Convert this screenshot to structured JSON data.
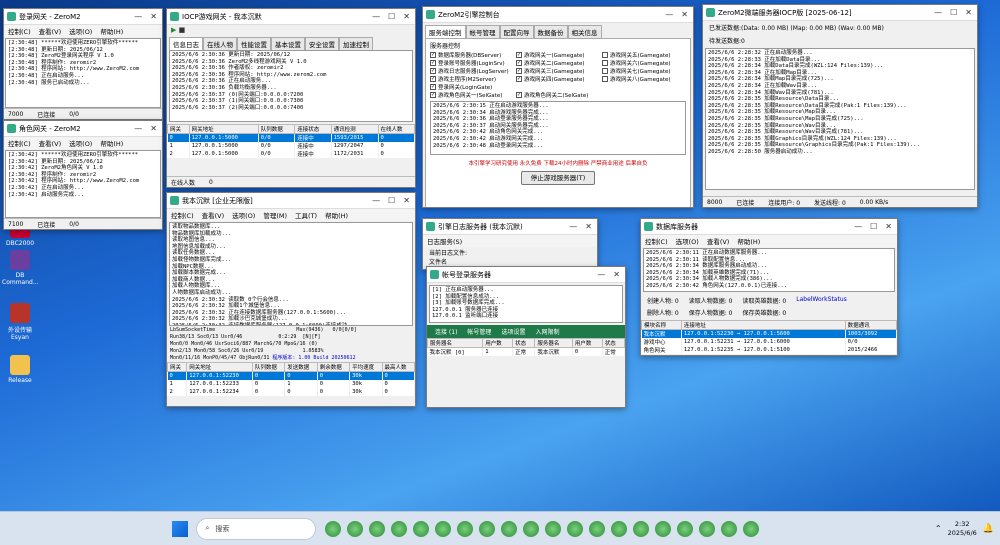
{
  "desktop": {
    "icons": [
      {
        "label": "DBC2000"
      },
      {
        "label": "DB Command..."
      },
      {
        "label": "外设传输 Esyan"
      },
      {
        "label": "Release"
      }
    ]
  },
  "w_gate": {
    "title": "登录网关 - ZeroM2",
    "menu": [
      "控制(C)",
      "查看(V)",
      "选项(O)",
      "帮助(H)"
    ],
    "log": "[2:30:48] ******欢迎使用ZERO引擎软件******\n[2:30:48] 更新日期: 2025/06/12\n[2:30:48] ZeroM2登录网关程序 V 1.0\n[2:30:48] 程序制作: zeromir2\n[2:30:48] 程序网站: http://www.ZeroM2.com\n[2:30:48] 正在启动服务...\n[2:30:48] 服务已启动成功...",
    "status": [
      "7000",
      "已连接",
      "0/0"
    ]
  },
  "w_selgate": {
    "title": "角色网关 - ZeroM2",
    "menu": [
      "控制(C)",
      "查看(V)",
      "选项(O)",
      "帮助(H)"
    ],
    "log": "[2:30:42] ******欢迎使用ZERO引擎软件******\n[2:30:42] 更新日期: 2025/06/12\n[2:30:42] ZeroM2角色网关 V 1.0\n[2:30:42] 程序制作: zeromir2\n[2:30:42] 程序网站: http://www.ZeroM2.com\n[2:30:42] 正在启动服务...\n[2:30:42] 启动服务完成...",
    "status": [
      "7100",
      "已连接",
      "0/0"
    ]
  },
  "w_iocp": {
    "title": "IOCP游戏网关 - 我本沉默",
    "tabs": [
      "信息日志",
      "在线人物",
      "性能设置",
      "基本设置",
      "安全设置",
      "加速控制"
    ],
    "log": "2025/6/6 2:30:36 更新日期: 2025/06/12\n2025/6/6 2:30:36 ZeroM2多线程游戏网关 V 1.0\n2025/6/6 2:30:36 作者版权: zeromir2\n2025/6/6 2:30:36 程序网站: http://www.zerom2.com\n2025/6/6 2:30:36 正在启动服务...\n2025/6/6 2:30:36 负载均衡服务器...\n2025/6/6 2:30:37 (0)网关端口:0.0.0.0:7200\n2025/6/6 2:30:37 (1)网关端口:0.0.0.0:7300\n2025/6/6 2:30:37 (2)网关端口:0.0.0.0:7400",
    "cols": [
      "网关",
      "网关地址",
      "队列数据",
      "连接状态",
      "通讯检测",
      "在线人数"
    ],
    "rows": [
      [
        "0",
        "127.0.0.1:5000",
        "0/0",
        "连接中",
        "1593/2015",
        "0"
      ],
      [
        "1",
        "127.0.0.1:5000",
        "0/0",
        "连接中",
        "1297/2047",
        "0"
      ],
      [
        "2",
        "127.0.0.1:5000",
        "0/0",
        "连接中",
        "1172/2031",
        "0"
      ]
    ],
    "footer_label": "在线人数",
    "footer_value": "0"
  },
  "w_ctrl": {
    "title": "ZeroM2引擎控制台",
    "tabs": [
      "服务端控制",
      "帐号管理",
      "配置向导",
      "数据备份",
      "相关信息"
    ],
    "group": "服务器控制",
    "checks": [
      [
        "数据库服务器(DBServer)",
        "游戏网关一(Gamegate)",
        "游戏网关五(Gamegate)"
      ],
      [
        "登录账号服务器(LoginSrv)",
        "游戏网关二(Gamegate)",
        "游戏网关六(Gamegate)"
      ],
      [
        "游戏日志服务器(LogServer)",
        "游戏网关三(Gamegate)",
        "游戏网关七(Gamegate)"
      ],
      [
        "游戏主程序(M2Server)",
        "游戏网关四(Gamegate)",
        "游戏网关八(Gamegate)"
      ],
      [
        "登录网关(LoginGate)",
        "",
        ""
      ],
      [
        "游戏角色网关一(SelGate)",
        "游戏角色网关二(SelGate)",
        ""
      ]
    ],
    "log": "2025/6/6 2:30:15 正在启动游戏服务器...\n2025/6/6 2:30:34 启动游戏服务器完成...\n2025/6/6 2:30:36 启动登录服务器完成...\n2025/6/6 2:30:37 启动网关服务器完成...\n2025/6/6 2:30:42 启动角色网关完成...\n2025/6/6 2:30:42 启动游戏网关完成...\n2025/6/6 2:30:48 启动登录网关完成...",
    "notice": "本引擎学习研究使用  永久免费  下载24小时内删除  严禁商业用途  后果自负",
    "stop_btn": "停止游戏服务器(T)"
  },
  "w_m2": {
    "title": "ZeroM2微端服务器IOCP版 [2025-06-12]",
    "stats": "已发送数据:(Data: 0.00 MB) (Map: 0.00 MB) (Wav: 0.00 MB)",
    "queue": "待发送数据:0",
    "log": "2025/6/6 2:28:32 正在启动服务器...\n2025/6/6 2:28:33 正在加载Data目录...\n2025/6/6 2:28:34 加载Data目录完成(WZL:124 Files:139)...\n2025/6/6 2:28:34 正在加载Map目录...\n2025/6/6 2:28:34 加载Map目录完成(725)...\n2025/6/6 2:28:34 正在加载Wav目录...\n2025/6/6 2:28:34 加载Wav目录完成(781)...\n2025/6/6 2:28:35 加载Resource\\Data目录...\n2025/6/6 2:28:35 加载Resource\\Data目录完成(Pak:1 Files:139)...\n2025/6/6 2:28:35 加载Resource\\Map目录...\n2025/6/6 2:28:35 加载Resource\\Map目录完成(725)...\n2025/6/6 2:28:35 加载Resource\\Wav目录...\n2025/6/6 2:28:35 加载Resource\\Wav目录完成(781)...\n2025/6/6 2:28:35 加载Graphics目录完成(WZL:124 Files:139)...\n2025/6/6 2:28:35 加载Resource\\Graphics目录完成(Pak:1 Files:139)...\n2025/6/6 2:28:50 服务器启动成功...",
    "status": [
      "8000",
      "已连接",
      "连接用户: 0",
      "发送线程: 0",
      "0.00 KB/s"
    ]
  },
  "w_m2srv": {
    "title": "我本沉默 [企业无限版]",
    "menu": [
      "控制(C)",
      "查看(V)",
      "选项(O)",
      "管理(M)",
      "工具(T)",
      "帮助(H)"
    ],
    "log": "读取物品数据库...\n物品数据库加载成功...\n读取地图信息...\n地图信息加载成功...\n读取任务数据...\n加载怪物数据库完成...\n加载NPC数据...\n加载脚本数据完成...\n加载商人数据...\n加载人物数据库...\n人物数据库启动成功...\n2025/6/6 2:30:32 读取数 0个行会信息...\n2025/6/6 2:30:32 加载1个城堡信息...\n2025/6/6 2:30:32 正在连接数据库服务器(127.0.0.1:5600)...\n2025/6/6 2:30:32 加载沙巴克城堡成功...\n2025/6/6 2:30:32 连接数据库服务器(127.0.0.1:6000)连接成功...",
    "info": [
      "LbSumSocketTime                           Max(9436)   0/0[0/0]",
      "Run38/13 Soc0/13 Usr0/46            0:2:29  [N][F]",
      "Mon0/0 Mon0/46 UsrSoci6/887 MarchG/70 MpoG/16 (0)",
      "Mon2/13 Mon0/58 Soc0/26 Usr0/19             1.0583%",
      "Mon0/11/16 MonP0/45/47 ObjRun0/31"
    ],
    "version": "程序版本: 1.00 Build 20250612",
    "cols": [
      "网关",
      "网关地址",
      "队列数据",
      "发送数据",
      "剩余数据",
      "平均速度",
      "最高人数"
    ],
    "rows": [
      [
        "0",
        "127.0.0.1:52230",
        "0",
        "0",
        "0",
        "30k",
        "0"
      ],
      [
        "1",
        "127.0.0.1:52233",
        "0",
        "1",
        "0",
        "30k",
        "0"
      ],
      [
        "2",
        "127.0.0.1:52234",
        "0",
        "0",
        "0",
        "30k",
        "0"
      ]
    ]
  },
  "w_log": {
    "title": "引擎日志服务器 (我本沉默)",
    "menu": [
      "日志服务(S)"
    ],
    "lines": [
      "当前日志文件:",
      "文件名"
    ]
  },
  "w_login": {
    "title": "帐号登录服务器",
    "log": "[1] 正在启动服务器...\n[2] 加载配置信息成功...\n[3] 加载账号数据库完成...\n127.0.0.1 服务器已连接\n127.0.0.1 监听端口连接",
    "tabs": [
      "连接 (1)",
      "帐号管理",
      "选项设置",
      "入网限制"
    ],
    "cols": [
      "服务器名",
      "用户数",
      "状态",
      "服务器名",
      "用户数",
      "状态"
    ],
    "row": [
      "我本沉默  [0]",
      "1",
      "正常",
      "我本沉默",
      "0",
      "正常"
    ]
  },
  "w_db": {
    "title": "数据库服务器",
    "menu": [
      "控制(C)",
      "选项(O)",
      "查看(V)",
      "帮助(H)"
    ],
    "log": "2025/6/6 2:30:11 正在启动数据库服务器...\n2025/6/6 2:30:11 读取配置信息...\n2025/6/6 2:30:34 数据库服务器启动成功...\n2025/6/6 2:30:34 加载英雄数据完成(71)...\n2025/6/6 2:30:34 加载人物数据完成(386)...\n2025/6/6 2:30:42 角色网关(127.0.0.1)已连接...",
    "stats1": [
      "创建人物: 0",
      "读取人物数据: 0",
      "读取英雄数据: 0",
      "LabelWorkStatus"
    ],
    "stats2": [
      "删除人物: 0",
      "保存人物数据: 0",
      "保存英雄数据: 0"
    ],
    "cols": [
      "模块名称",
      "连接地址",
      "数据通讯"
    ],
    "rows": [
      [
        "我本沉默",
        "127.0.0.1:52230 → 127.0.0.1:5600",
        "1003/3092"
      ],
      [
        "游戏中心",
        "127.0.0.1:52231 → 127.0.0.1:6000",
        "0/0"
      ],
      [
        "角色网关",
        "127.0.0.1:52235 → 127.0.0.1:5100",
        "2015/2466"
      ]
    ]
  },
  "taskbar": {
    "search": "搜索",
    "time": "2:32",
    "date": "2025/6/6"
  },
  "colors": {
    "accent": "#0078d7",
    "title_green": "#1f7a4a",
    "desktop": "#1d6ad6"
  }
}
